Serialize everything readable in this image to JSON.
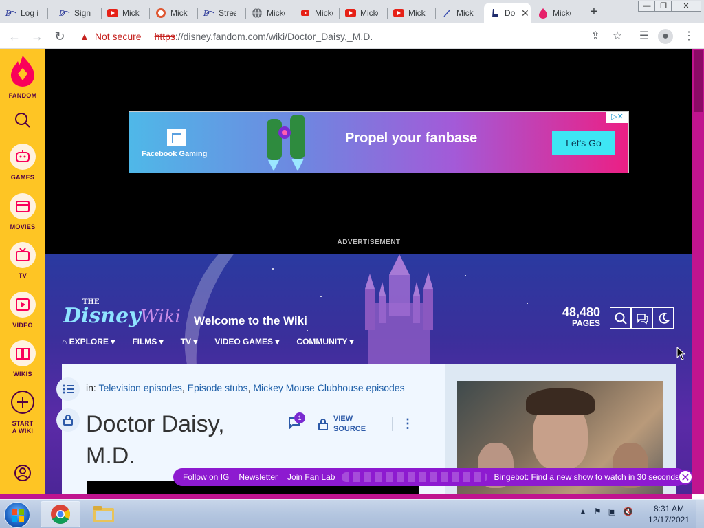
{
  "browser": {
    "tabs": [
      {
        "title": "Log in",
        "icon": "disney-plus-icon"
      },
      {
        "title": "Sign in",
        "icon": "disney-plus-icon"
      },
      {
        "title": "Mickey",
        "icon": "youtube-icon"
      },
      {
        "title": "Mickey",
        "icon": "duckduckgo-icon"
      },
      {
        "title": "Stream",
        "icon": "disney-plus-icon"
      },
      {
        "title": "Mickey",
        "icon": "globe-icon"
      },
      {
        "title": "Mickey",
        "icon": "youtube-icon"
      },
      {
        "title": "Mickey",
        "icon": "youtube-icon"
      },
      {
        "title": "Mickey",
        "icon": "youtube-icon"
      },
      {
        "title": "Mickey",
        "icon": "wand-icon"
      },
      {
        "title": "Do",
        "icon": "wiki-icon",
        "active": true
      },
      {
        "title": "Mickey",
        "icon": "fandom-icon"
      }
    ],
    "new_tab_label": "+",
    "security_label": "Not secure",
    "url_scheme": "https",
    "url_rest": "://disney.fandom.com/wiki/Doctor_Daisy,_M.D."
  },
  "fandom_rail": {
    "brand": "FANDOM",
    "items": [
      {
        "label": "GAMES",
        "icon": "gamepad-icon"
      },
      {
        "label": "MOVIES",
        "icon": "clapperboard-icon"
      },
      {
        "label": "TV",
        "icon": "tv-icon"
      },
      {
        "label": "VIDEO",
        "icon": "play-icon"
      },
      {
        "label": "WIKIS",
        "icon": "book-icon"
      },
      {
        "label": "START A WIKI",
        "icon": "plus-circle-icon"
      }
    ]
  },
  "ad": {
    "brand": "Facebook Gaming",
    "headline": "Propel your fanbase",
    "cta": "Let's Go",
    "label": "ADVERTISEMENT"
  },
  "wiki_header": {
    "logo_the": "THE",
    "logo_disney": "Disney",
    "logo_wiki": "Wiki",
    "welcome": "Welcome to the Wiki",
    "pages_count": "48,480",
    "pages_label": "PAGES",
    "nav": [
      "EXPLORE",
      "FILMS",
      "TV",
      "VIDEO GAMES",
      "COMMUNITY"
    ]
  },
  "article": {
    "categories_prefix": "in:",
    "categories": [
      "Television episodes",
      "Episode stubs",
      "Mickey Mouse Clubhouse episodes"
    ],
    "title": "Doctor Daisy, M.D.",
    "talk_count": "1",
    "view_source": "VIEW SOURCE"
  },
  "bottom_bar": {
    "items": [
      "Follow on IG",
      "Newsletter",
      "Join Fan Lab"
    ],
    "bingebot": "Bingebot: Find a new show to watch in 30 seconds"
  },
  "taskbar": {
    "time": "8:31 AM",
    "date": "12/17/2021"
  },
  "colors": {
    "fandom_yellow": "#fec524",
    "fandom_pink": "#c0148f",
    "bottom_bar": "#8d1ad0",
    "link_blue": "#1e5fa8"
  }
}
